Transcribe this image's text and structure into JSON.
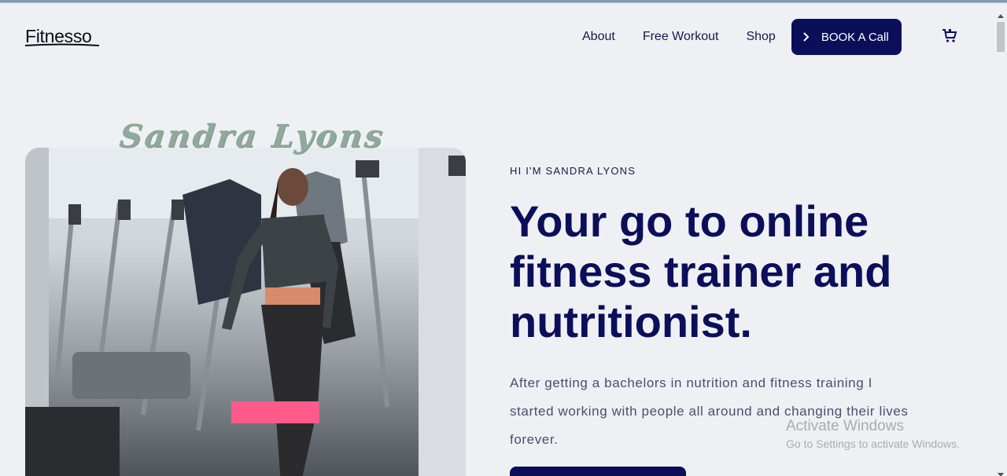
{
  "header": {
    "logo_text": "Fitnesso",
    "nav": [
      {
        "label": "About"
      },
      {
        "label": "Free Workout"
      },
      {
        "label": "Shop"
      }
    ],
    "book_button_label": "BOOK A Call",
    "cart_icon": "cart-icon"
  },
  "hero": {
    "script_name": "Sandra Lyons",
    "eyebrow": "HI I'M SANDRA LYONS",
    "headline": "Your go to online fitness trainer and nutritionist.",
    "paragraph": "After getting a bachelors in nutrition and fitness training I started working with people all around and changing their lives forever.",
    "photo_alt": "Woman in fitness outfit at gym"
  },
  "watermark": {
    "title": "Activate Windows",
    "subtitle": "Go to Settings to activate Windows."
  },
  "colors": {
    "accent": "#0b0f5a",
    "background": "#eff0f4",
    "script": "#8fa99a"
  }
}
